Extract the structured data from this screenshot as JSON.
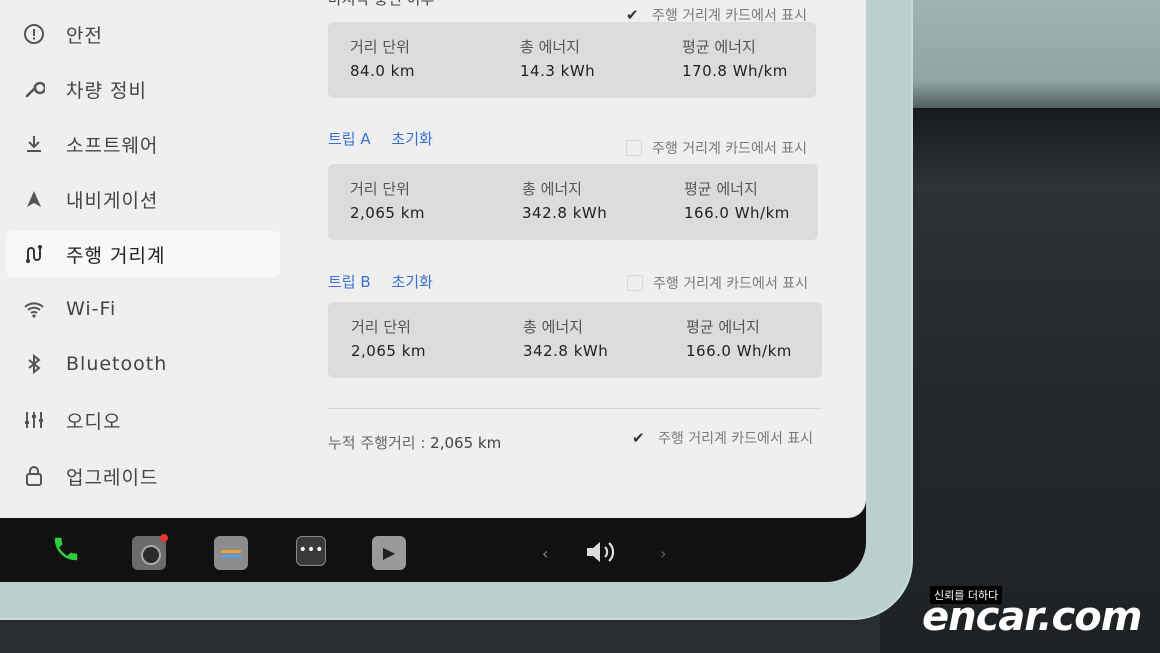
{
  "sidebar": {
    "items": [
      {
        "label": "안전",
        "icon": "alert-circle-icon"
      },
      {
        "label": "차량 정비",
        "icon": "wrench-icon"
      },
      {
        "label": "소프트웨어",
        "icon": "download-icon"
      },
      {
        "label": "내비게이션",
        "icon": "navigation-arrow-icon"
      },
      {
        "label": "주행 거리계",
        "icon": "trip-odometer-icon",
        "active": true
      },
      {
        "label": "Wi-Fi",
        "icon": "wifi-icon"
      },
      {
        "label": "Bluetooth",
        "icon": "bluetooth-icon"
      },
      {
        "label": "오디오",
        "icon": "equalizer-icon"
      },
      {
        "label": "업그레이드",
        "icon": "lock-bag-icon"
      }
    ]
  },
  "main": {
    "show_on_card_label": "주행 거리계 카드에서 표시",
    "top_section": {
      "header": "마지막 충전 이후",
      "checked": true,
      "distance_label": "거리 단위",
      "distance_value": "84.0 km",
      "energy_label": "총 에너지",
      "energy_value": "14.3 kWh",
      "avg_label": "평균 에너지",
      "avg_value": "170.8 Wh/km"
    },
    "trip_a": {
      "name": "트립 A",
      "reset": "초기화",
      "checked": false,
      "distance_label": "거리 단위",
      "distance_value": "2,065 km",
      "energy_label": "총 에너지",
      "energy_value": "342.8 kWh",
      "avg_label": "평균 에너지",
      "avg_value": "166.0 Wh/km"
    },
    "trip_b": {
      "name": "트립 B",
      "reset": "초기화",
      "checked": false,
      "distance_label": "거리 단위",
      "distance_value": "2,065 km",
      "energy_label": "총 에너지",
      "energy_value": "342.8 kWh",
      "avg_label": "평균 에너지",
      "avg_value": "166.0 Wh/km"
    },
    "odometer": {
      "label": "누적 주행거리 :",
      "value": "2,065 km",
      "checked": true
    }
  },
  "taskbar": {
    "icons": [
      "phone-icon",
      "camera-icon",
      "apps-icon",
      "more-icon",
      "media-icon",
      "chevron-left-icon",
      "volume-icon",
      "chevron-right-icon"
    ],
    "phone_color": "#2ecc40"
  },
  "watermark": {
    "small_text": "신뢰를 더하다",
    "brand": "encar.com"
  },
  "colors": {
    "accent_link": "#3b6fd8",
    "screen_bg": "#efefef",
    "bezel": "#b9d0cd"
  }
}
